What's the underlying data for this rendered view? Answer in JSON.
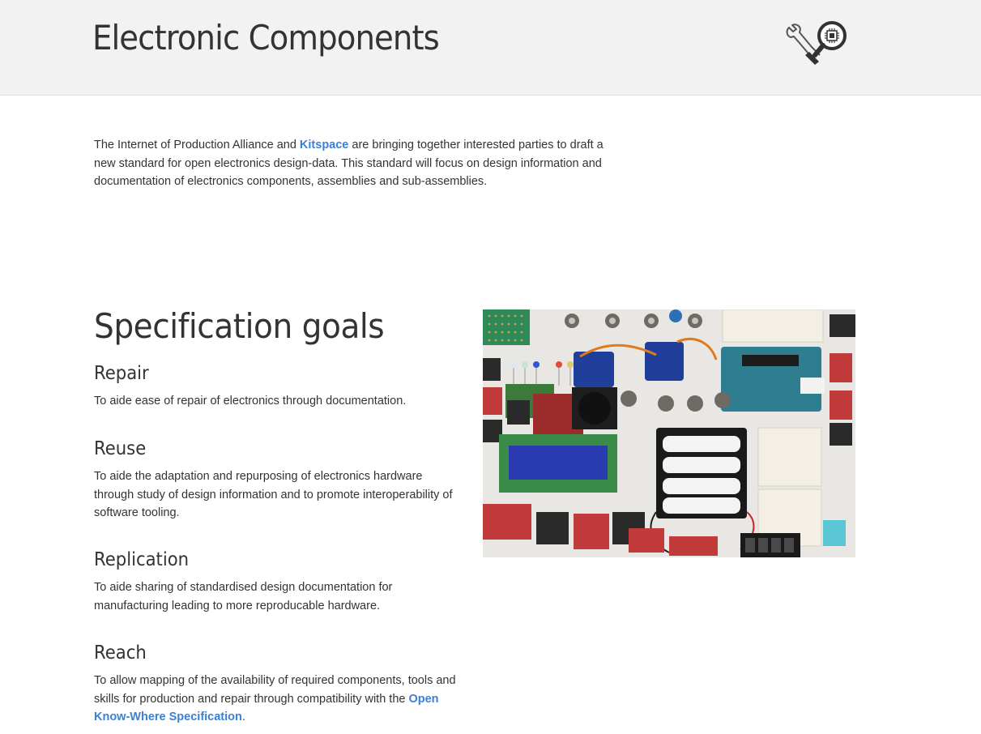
{
  "header": {
    "title": "Electronic Components",
    "logo_icon": "wrench-chip-magnifier-icon"
  },
  "intro": {
    "text_before": "The Internet of Production Alliance and ",
    "link_label": "Kitspace",
    "text_after": " are bringing together interested parties to draft a new standard for open electronics design-data. This standard will focus on design information and documentation of electronics components, assemblies and sub-assemblies."
  },
  "goals": {
    "title": "Specification goals",
    "items": [
      {
        "heading": "Repair",
        "text": "To aide ease of repair of electronics through documentation."
      },
      {
        "heading": "Reuse",
        "text": "To aide the adaptation and repurposing of electronics hardware through study of design information and to promote interoperability of software tooling."
      },
      {
        "heading": "Replication",
        "text": "To aide sharing of standardised design documentation for manufacturing leading to more reproducable hardware."
      },
      {
        "heading": "Reach",
        "text_before": "To allow mapping of the availability of required components, tools and skills for production and repair through compatibility with the ",
        "link_label": "Open Know-Where Specification",
        "text_after": "."
      }
    ]
  },
  "photo": {
    "alt": "electronics-components-photo"
  },
  "colors": {
    "header_bg": "#f2f2f2",
    "link": "#3b7fd6",
    "text": "#333333"
  }
}
